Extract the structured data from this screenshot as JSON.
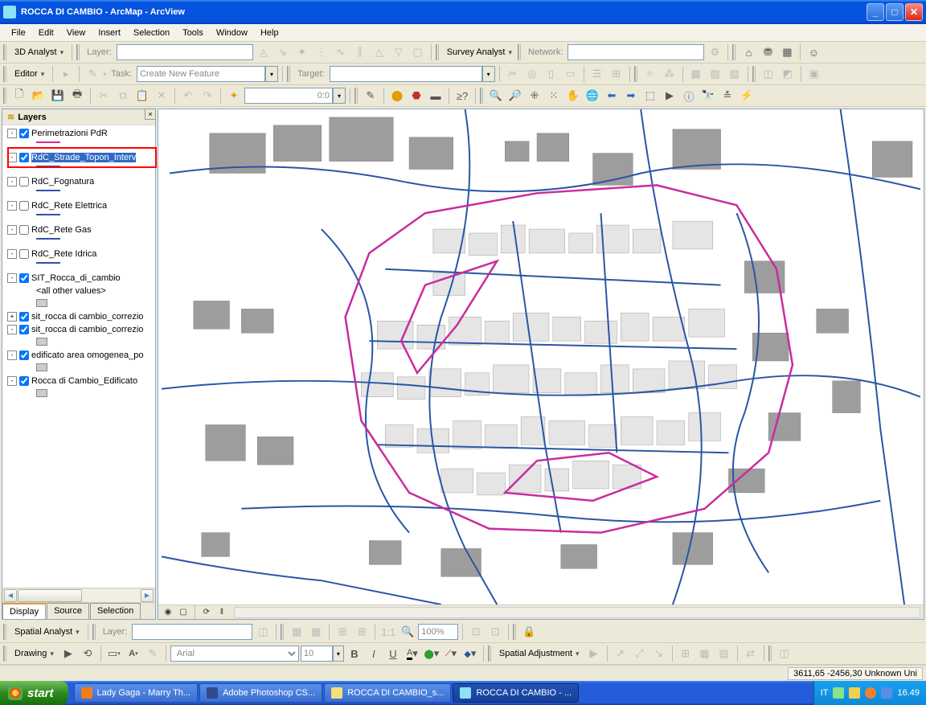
{
  "window": {
    "title": "ROCCA DI CAMBIO - ArcMap - ArcView"
  },
  "menus": [
    "File",
    "Edit",
    "View",
    "Insert",
    "Selection",
    "Tools",
    "Window",
    "Help"
  ],
  "tb1": {
    "analyst": "3D Analyst",
    "layerLabel": "Layer:",
    "survey": "Survey Analyst",
    "networkLabel": "Network:"
  },
  "tb2": {
    "editor": "Editor",
    "taskLabel": "Task:",
    "taskValue": "Create New Feature",
    "targetLabel": "Target:"
  },
  "tb3": {
    "scale": "0:0"
  },
  "tb_spatial": {
    "label": "Spatial Analyst",
    "layerLabel": "Layer:"
  },
  "tb_draw": {
    "label": "Drawing",
    "font": "Arial",
    "size": "10",
    "bold": "B",
    "italic": "I",
    "underline": "U",
    "adjust": "Spatial Adjustment"
  },
  "toc": {
    "title": "Layers",
    "items": [
      {
        "exp": "-",
        "chk": true,
        "name": "Perimetrazioni PdR",
        "swatch": "#d42b9c"
      },
      {
        "exp": "-",
        "chk": true,
        "name": "RdC_Strade_Topon_Interv",
        "swatch": "#2856a5",
        "sel": true
      },
      {
        "exp": "-",
        "chk": false,
        "name": "RdC_Fognatura",
        "swatch": "#2856a5"
      },
      {
        "exp": "-",
        "chk": false,
        "name": "RdC_Rete Elettrica",
        "swatch": "#2856a5"
      },
      {
        "exp": "-",
        "chk": false,
        "name": "RdC_Rete Gas",
        "swatch": "#2856a5"
      },
      {
        "exp": "-",
        "chk": false,
        "name": "RdC_Rete Idrica",
        "swatch": "#2856a5"
      },
      {
        "exp": "-",
        "chk": true,
        "name": "SIT_Rocca_di_cambio",
        "sub": "<all other values>",
        "subsw": "#cccccc"
      },
      {
        "exp": "+",
        "chk": true,
        "name": "sit_rocca di cambio_correzio"
      },
      {
        "exp": "-",
        "chk": true,
        "name": "sit_rocca di cambio_correzio",
        "subsw": "#cccccc"
      },
      {
        "exp": "-",
        "chk": true,
        "name": "edificato area omogenea_po",
        "subsw": "#cccccc"
      },
      {
        "exp": "-",
        "chk": true,
        "name": "Rocca di Cambio_Edificato",
        "subsw": "#cccccc"
      }
    ],
    "tabs": [
      "Display",
      "Source",
      "Selection"
    ]
  },
  "status": {
    "coords": "3611,65 -2456,30 Unknown Uni"
  },
  "taskbar": {
    "start": "start",
    "tasks": [
      {
        "label": "Lady Gaga - Marry Th...",
        "iconColor": "#f07d1a"
      },
      {
        "label": "Adobe Photoshop CS...",
        "iconColor": "#2f4b8f"
      },
      {
        "label": "ROCCA DI CAMBIO_s...",
        "iconColor": "#f5de7b"
      },
      {
        "label": "ROCCA DI CAMBIO - ...",
        "iconColor": "#8de2f7",
        "active": true
      }
    ],
    "lang": "IT",
    "clock": "16.49"
  },
  "chart_data": {
    "type": "map",
    "note": "GIS cadastral map view of Rocca di Cambio. Grey polygons are building footprints; blue polylines are street/toponym intervention layer (RdC_Strade_Topon_Interv); magenta polylines are PdR perimeter boundaries."
  }
}
